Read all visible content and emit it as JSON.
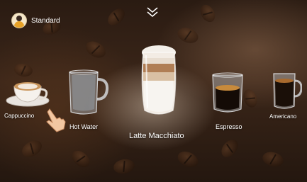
{
  "header": {
    "mode_label": "Standard",
    "avatar_icon": "user-avatar-icon",
    "collapse_icon": "double-chevron-down-icon"
  },
  "drinks": [
    {
      "label": "Cappuccino",
      "icon": "cappuccino-cup-icon"
    },
    {
      "label": "Hot Water",
      "icon": "hot-water-glass-icon"
    },
    {
      "label": "Latte Macchiato",
      "icon": "latte-macchiato-glass-icon",
      "selected": true
    },
    {
      "label": "Espresso",
      "icon": "espresso-glass-icon"
    },
    {
      "label": "Americano",
      "icon": "americano-glass-icon"
    }
  ],
  "pointer_icon": "hand-pointer-icon"
}
